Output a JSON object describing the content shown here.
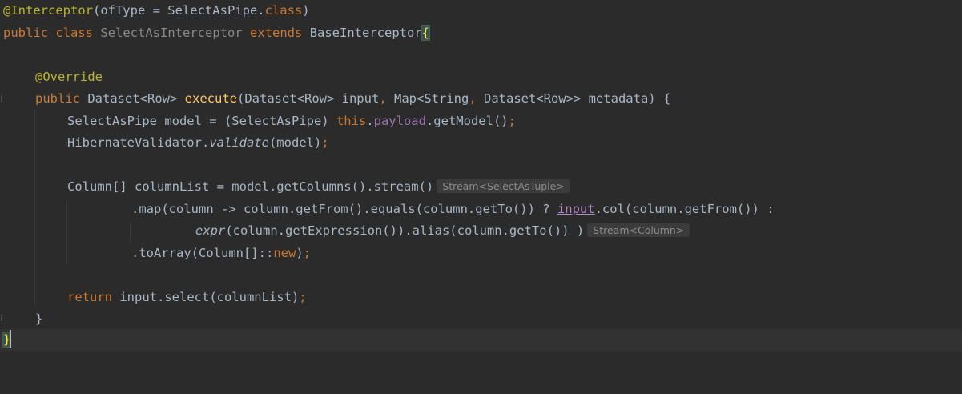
{
  "editor": {
    "language": "Java",
    "theme": "dark",
    "lines": [
      {
        "annotation": "@Interceptor",
        "open": "(ofType = SelectAsPipe.",
        "class_kw": "class",
        "close": ")"
      },
      {
        "public_kw": "public",
        "class_kw": "class",
        "class_name": "SelectAsInterceptor",
        "extends_kw": "extends",
        "base_class": "BaseInterceptor",
        "brace": "{"
      },
      {},
      {
        "annotation": "@Override"
      },
      {
        "public_kw": "public",
        "type": "Dataset<Row>",
        "method": "execute",
        "params_a": "(Dataset<Row> input",
        "comma1": ",",
        "params_b": " Map<String",
        "comma2": ",",
        "params_c": " Dataset<Row>> metadata) {"
      },
      {
        "text_a": "SelectAsPipe model = (SelectAsPipe) ",
        "this_kw": "this",
        "dot": ".",
        "field": "payload",
        "text_b": ".getModel()",
        "semi": ";"
      },
      {
        "text_a": "HibernateValidator.",
        "static_call": "validate",
        "text_b": "(model)",
        "semi": ";"
      },
      {},
      {
        "text": "Column[] columnList = model.getColumns().stream()",
        "hint": "Stream<SelectAsTuple>"
      },
      {
        "text_a": ".map(column -> column.getFrom().equals(column.getTo()) ? ",
        "input_ref": "input",
        "text_b": ".col(column.getFrom()) :"
      },
      {
        "static_call": "expr",
        "text": "(column.getExpression()).alias(column.getTo()) )",
        "hint": "Stream<Column>"
      },
      {
        "text_a": ".toArray(Column[]::",
        "new_kw": "new",
        "text_b": ")",
        "semi": ";"
      },
      {},
      {
        "return_kw": "return",
        "text": " input.select(columnList)",
        "semi": ";"
      },
      {
        "brace": "}"
      },
      {
        "brace": "}"
      }
    ]
  }
}
